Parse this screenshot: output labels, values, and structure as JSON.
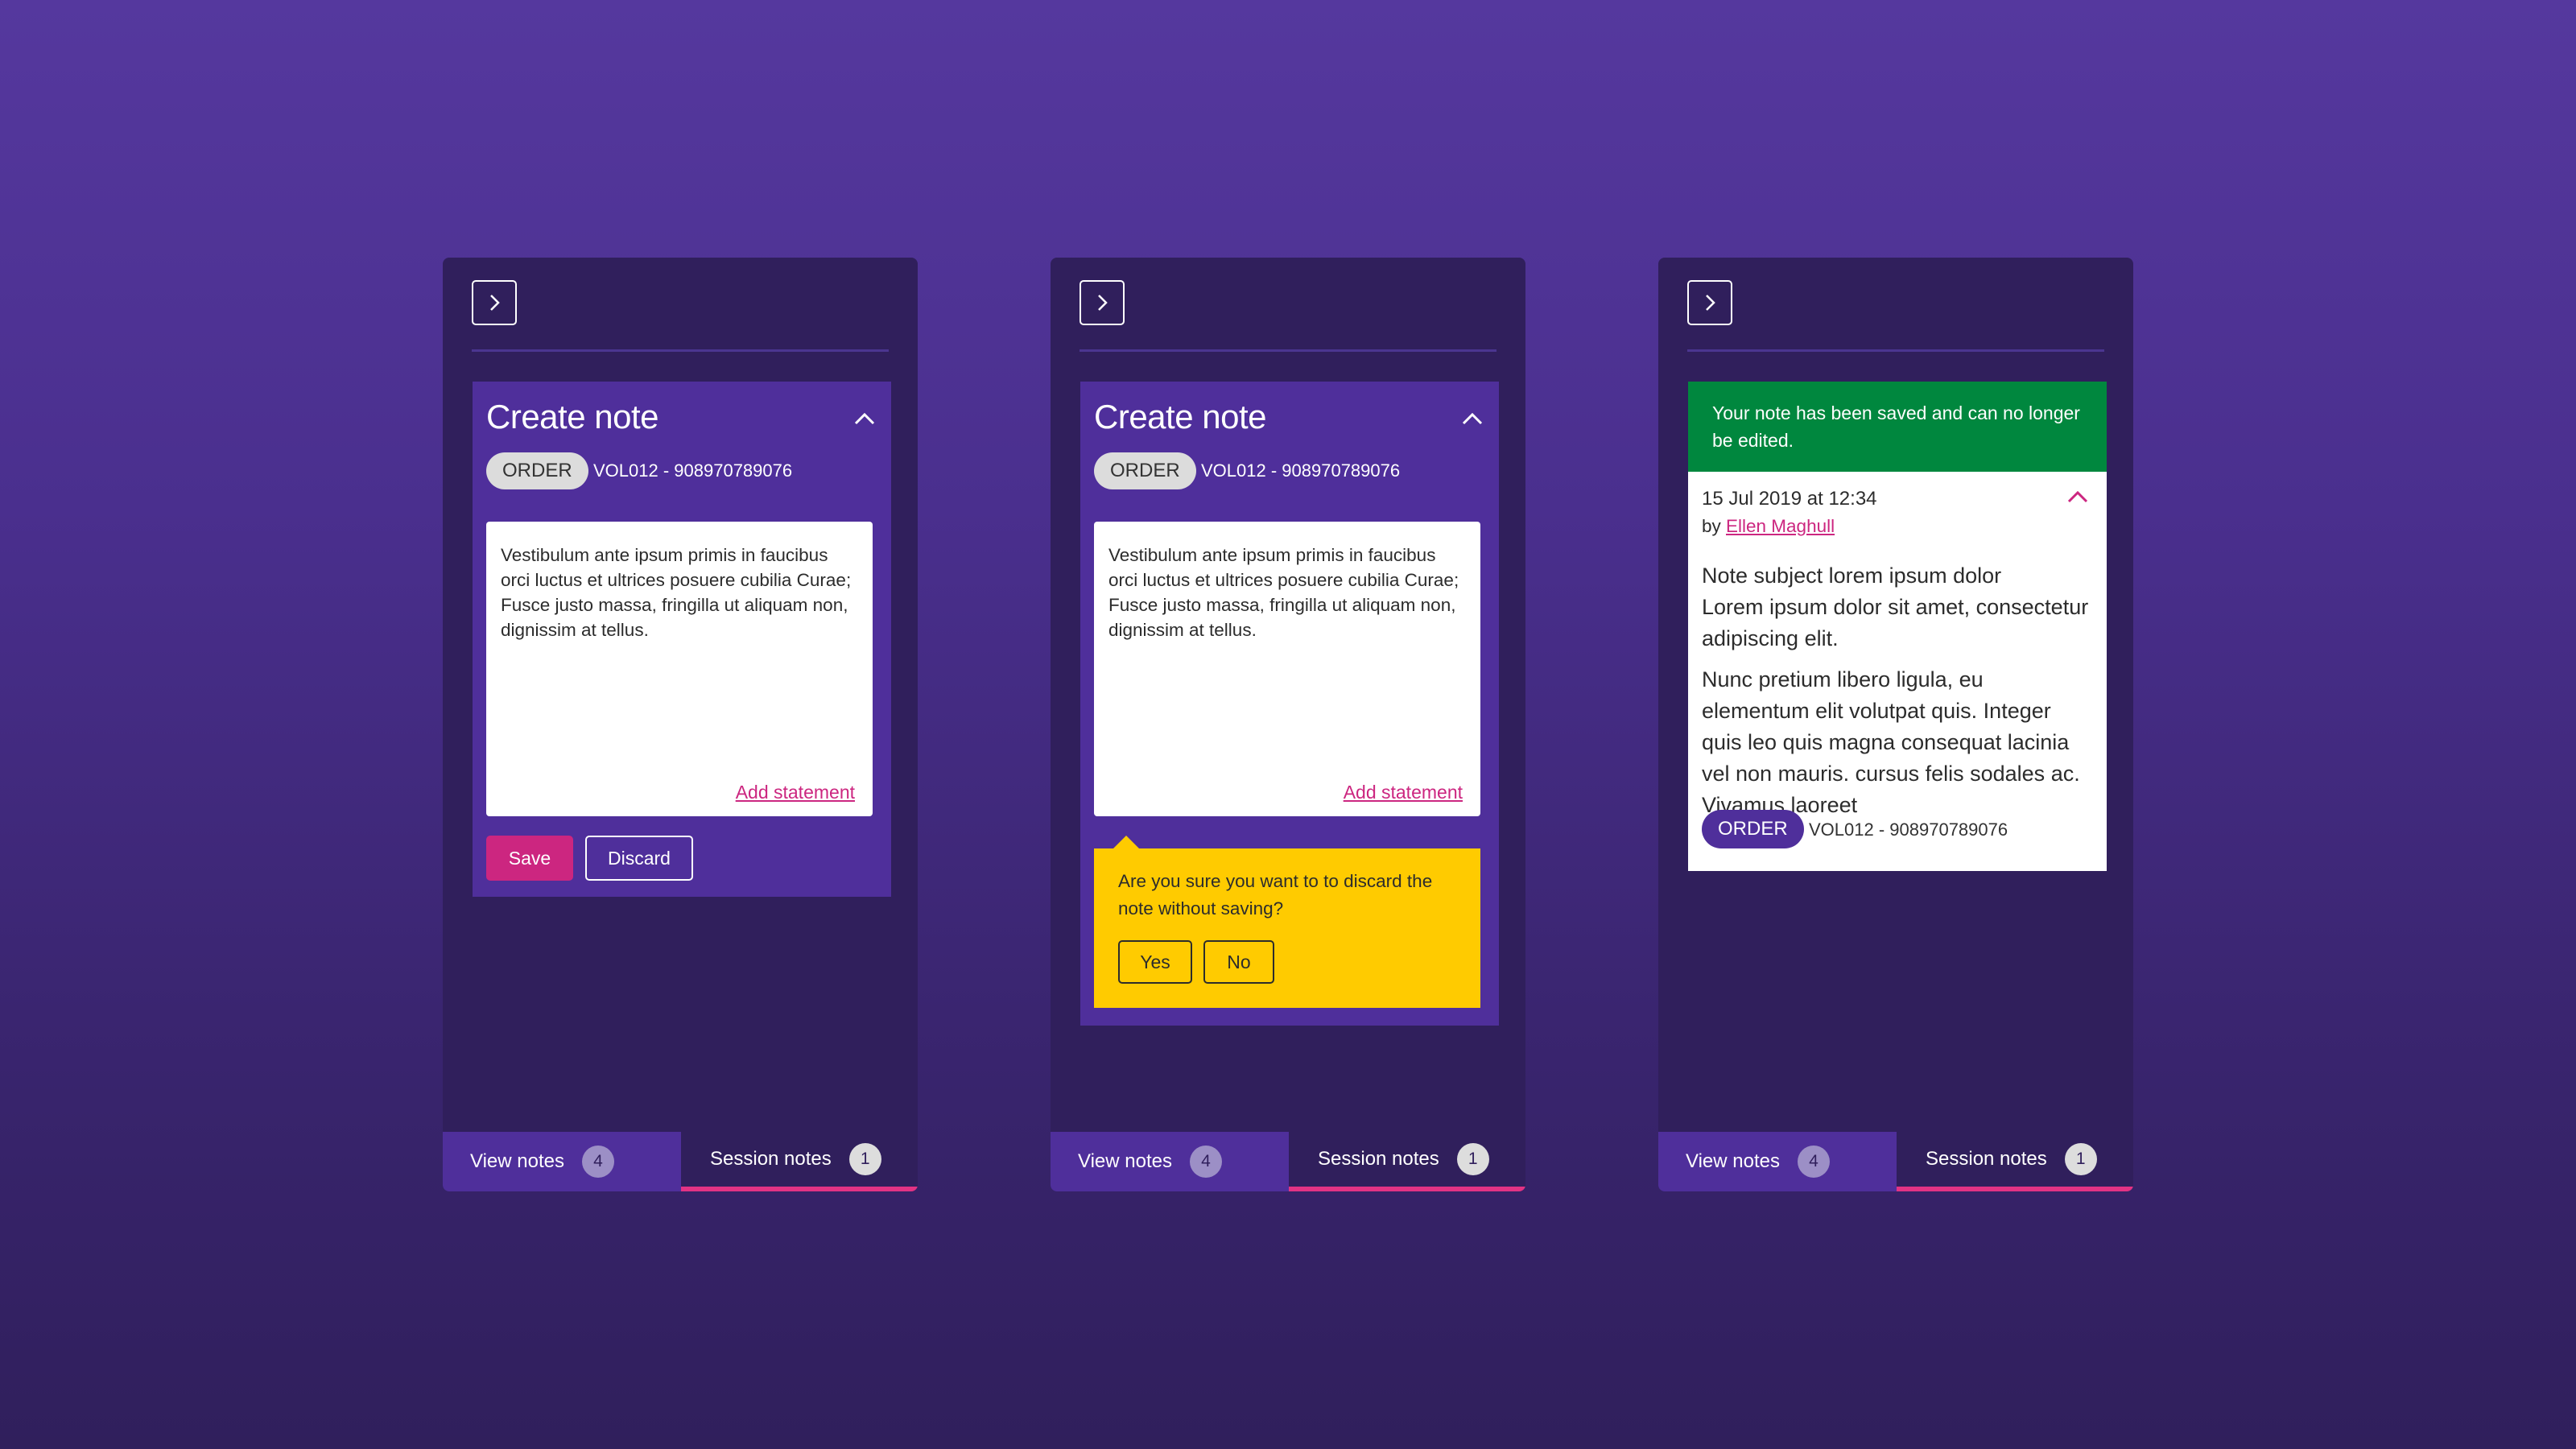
{
  "colors": {
    "background": "#4a2f8e",
    "panel": "#301f5c",
    "card": "#4f2f9b",
    "accent_pink": "#cc2680",
    "warning_yellow": "#ffcb00",
    "success_green": "#00873e",
    "tab_underline": "#e23384"
  },
  "icons": {
    "expand": "chevron-right-icon",
    "collapse": "chevron-up-icon"
  },
  "panels": [
    {
      "create_note": {
        "title": "Create note",
        "tag": "ORDER",
        "reference": "VOL012 - 908970789076",
        "note_text": "Vestibulum ante ipsum primis in faucibus orci luctus et ultrices posuere cubilia Curae; Fusce justo massa, fringilla ut aliquam non, dignissim at tellus.",
        "add_statement": "Add statement",
        "save_label": "Save",
        "discard_label": "Discard"
      },
      "tabs": {
        "view_notes": "View notes",
        "view_count": "4",
        "session_notes": "Session notes",
        "session_count": "1"
      }
    },
    {
      "create_note": {
        "title": "Create note",
        "tag": "ORDER",
        "reference": "VOL012 - 908970789076",
        "note_text": "Vestibulum ante ipsum primis in faucibus orci luctus et ultrices posuere cubilia Curae; Fusce justo massa, fringilla ut aliquam non, dignissim at tellus.",
        "add_statement": "Add statement"
      },
      "confirm": {
        "message": "Are you sure you want to to discard the note without saving?",
        "yes_label": "Yes",
        "no_label": "No"
      },
      "tabs": {
        "view_notes": "View notes",
        "view_count": "4",
        "session_notes": "Session notes",
        "session_count": "1"
      }
    },
    {
      "banner": "Your note has been saved and can no longer be edited.",
      "saved_note": {
        "date": "15 Jul 2019 at 12:34",
        "by_prefix": "by ",
        "author": "Ellen Maghull",
        "subject": "Note subject lorem ipsum dolor",
        "line1": "Lorem ipsum dolor sit amet, consectetur adipiscing elit.",
        "paragraph": "Nunc pretium libero ligula, eu elementum elit volutpat quis. Integer quis leo quis magna consequat lacinia vel non mauris. cursus felis sodales ac. Vivamus laoreet",
        "tag": "ORDER",
        "reference": "VOL012 - 908970789076"
      },
      "tabs": {
        "view_notes": "View notes",
        "view_count": "4",
        "session_notes": "Session notes",
        "session_count": "1"
      }
    }
  ]
}
